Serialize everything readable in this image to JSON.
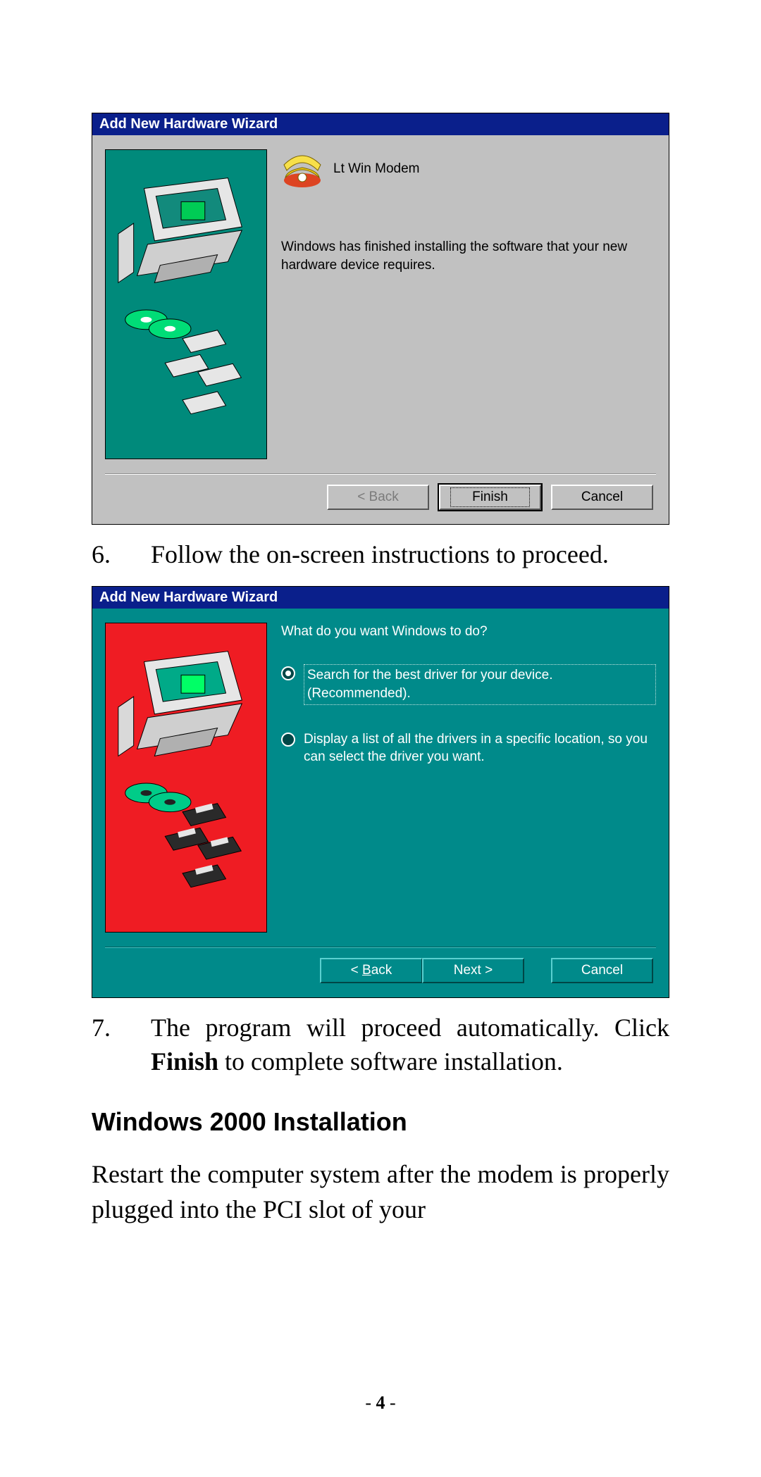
{
  "dialog1": {
    "title": "Add New Hardware Wizard",
    "device_label": "Lt Win Modem",
    "message": "Windows has finished installing the software that your new hardware device requires.",
    "buttons": {
      "back": "< Back",
      "finish": "Finish",
      "cancel": "Cancel"
    }
  },
  "step6": {
    "num": "6.",
    "text": "Follow the on-screen instructions to proceed."
  },
  "dialog2": {
    "title": "Add New Hardware Wizard",
    "question": "What do you want Windows to do?",
    "option1": "Search for the best driver for your device. (Recommended).",
    "option2": "Display a list of all the drivers in a specific location, so you can select the driver you want.",
    "buttons": {
      "back_pre": "< ",
      "back_u": "B",
      "back_post": "ack",
      "next": "Next >",
      "cancel": "Cancel"
    }
  },
  "step7": {
    "num": "7.",
    "text_pre": "The program will proceed automatically. Click ",
    "finish_word": "Finish",
    "text_post": " to complete software installation."
  },
  "heading": "Windows 2000 Installation",
  "paragraph": "Restart the computer system after the modem is properly plugged into the PCI slot of your",
  "page_number": "4"
}
